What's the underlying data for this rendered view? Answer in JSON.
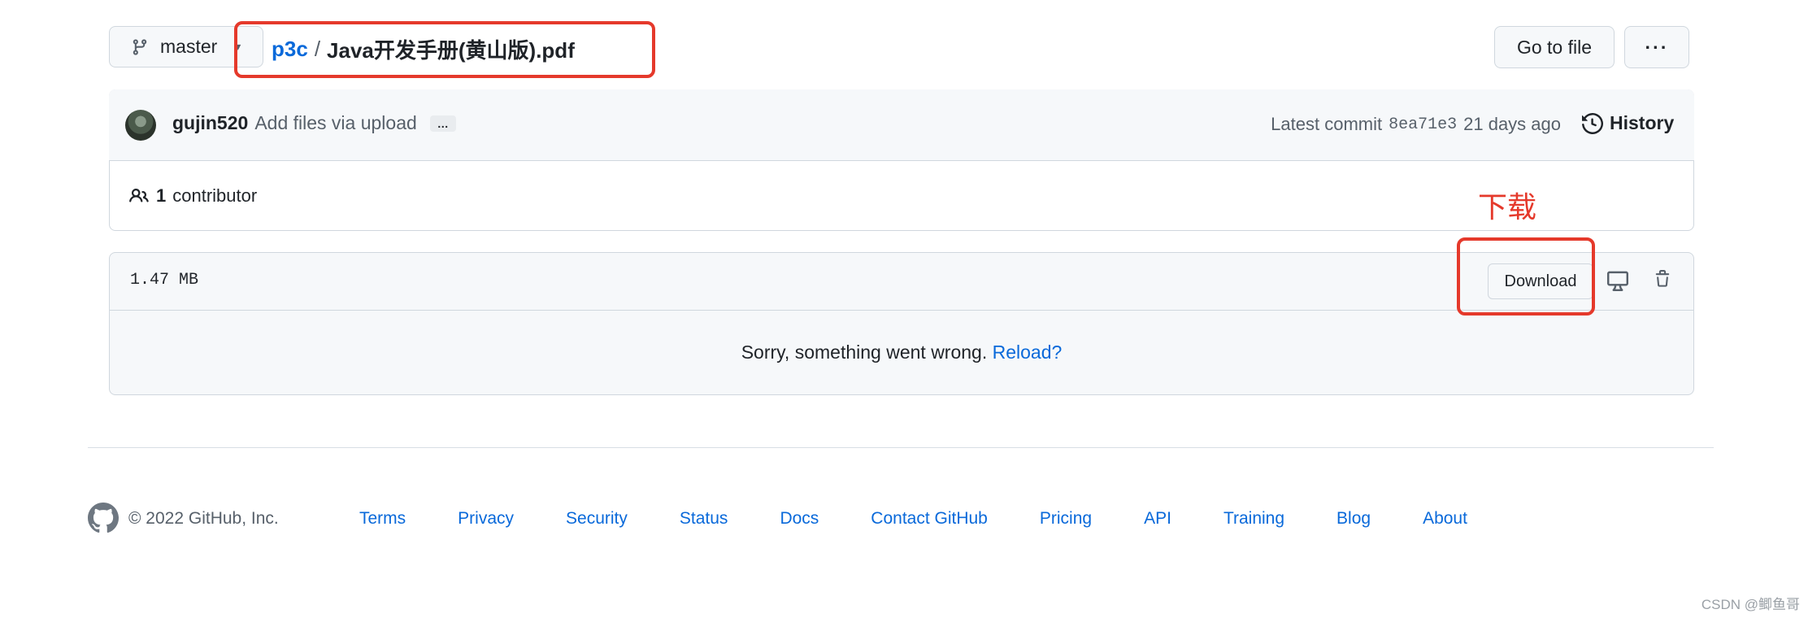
{
  "branch": {
    "name": "master"
  },
  "breadcrumb": {
    "repo": "p3c",
    "separator": "/",
    "file": "Java开发手册(黄山版).pdf"
  },
  "header_actions": {
    "go_to_file": "Go to file",
    "more": "···"
  },
  "commit": {
    "author": "gujin520",
    "message": "Add files via upload",
    "ellipsis": "…",
    "latest_prefix": "Latest commit",
    "sha": "8ea71e3",
    "time": "21 days ago",
    "history_label": "History"
  },
  "contributors": {
    "count": "1",
    "label": "contributor"
  },
  "annotation": {
    "text": "下载",
    "color": "#e5392b"
  },
  "file": {
    "size": "1.47 MB",
    "download_label": "Download",
    "error_text": "Sorry, something went wrong.",
    "reload_label": "Reload?"
  },
  "footer": {
    "copyright": "© 2022 GitHub, Inc.",
    "links": [
      "Terms",
      "Privacy",
      "Security",
      "Status",
      "Docs",
      "Contact GitHub",
      "Pricing",
      "API",
      "Training",
      "Blog",
      "About"
    ]
  },
  "watermark": "CSDN @鲫鱼哥",
  "colors": {
    "link": "#0969da",
    "border": "#d0d7de",
    "highlight": "#e5392b"
  }
}
